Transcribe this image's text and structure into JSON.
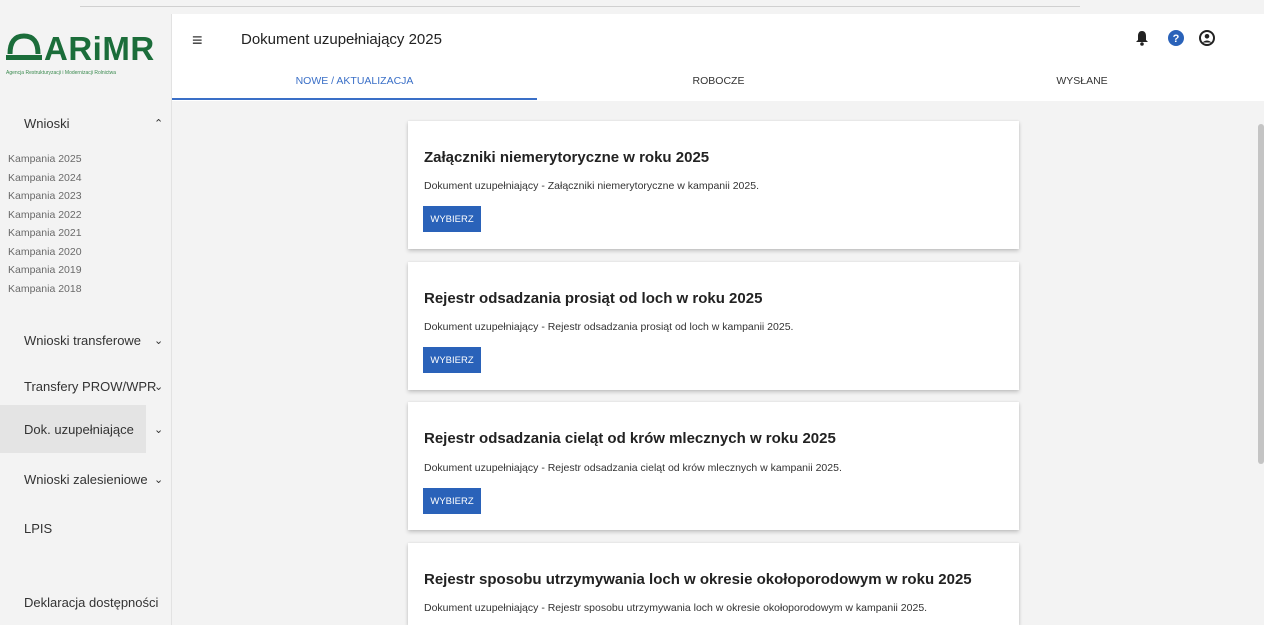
{
  "logo": {
    "text": "ARiMR",
    "subtitle": "Agencja Restrukturyzacji i Modernizacji Rolnictwa"
  },
  "header": {
    "title": "Dokument uzupełniający 2025"
  },
  "tabs": [
    {
      "label": "NOWE / AKTUALIZACJA",
      "active": true
    },
    {
      "label": "ROBOCZE",
      "active": false
    },
    {
      "label": "WYSŁANE",
      "active": false
    }
  ],
  "sidebar": {
    "wnioski": "Wnioski",
    "campaigns": [
      "Kampania 2025",
      "Kampania 2024",
      "Kampania 2023",
      "Kampania 2022",
      "Kampania 2021",
      "Kampania 2020",
      "Kampania 2019",
      "Kampania 2018"
    ],
    "items": [
      {
        "label": "Wnioski transferowe"
      },
      {
        "label": "Transfery PROW/WPR"
      },
      {
        "label": "Dok. uzupełniające",
        "active": true
      },
      {
        "label": "Wnioski zalesieniowe"
      },
      {
        "label": "LPIS"
      },
      {
        "label": "Deklaracja dostępności"
      }
    ]
  },
  "cards": [
    {
      "title": "Załączniki niemerytoryczne w roku 2025",
      "description": "Dokument uzupełniający - Załączniki niemerytoryczne w kampanii 2025.",
      "button": "WYBIERZ"
    },
    {
      "title": "Rejestr odsadzania prosiąt od loch w roku 2025",
      "description": "Dokument uzupełniający - Rejestr odsadzania prosiąt od loch w kampanii 2025.",
      "button": "WYBIERZ"
    },
    {
      "title": "Rejestr odsadzania cieląt od krów mlecznych w roku 2025",
      "description": "Dokument uzupełniający - Rejestr odsadzania cieląt od krów mlecznych w kampanii 2025.",
      "button": "WYBIERZ"
    },
    {
      "title": "Rejestr sposobu utrzymywania loch w okresie okołoporodowym w roku 2025",
      "description": "Dokument uzupełniający - Rejestr sposobu utrzymywania loch w okresie okołoporodowym w kampanii 2025.",
      "button": "WYBIERZ"
    }
  ],
  "colors": {
    "brand": "#1b6d3a",
    "accent": "#3a6fc7",
    "button": "#2a62b9"
  },
  "icons": [
    "menu-icon",
    "bell-icon",
    "help-icon",
    "user-icon",
    "chevron-up-icon",
    "chevron-down-icon"
  ]
}
